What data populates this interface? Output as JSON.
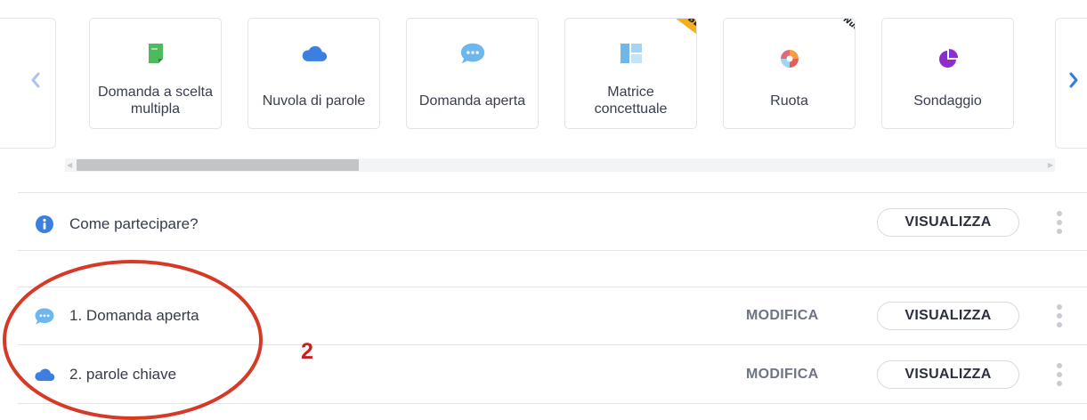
{
  "carousel": {
    "prev_icon": "chevron-left-icon",
    "next_icon": "chevron-right-icon",
    "cards": [
      {
        "label": "Domanda a scelta multipla",
        "icon": "document-icon",
        "color": "#4dbb5d"
      },
      {
        "label": "Nuvola di parole",
        "icon": "cloud-icon",
        "color": "#3d7fe0"
      },
      {
        "label": "Domanda aperta",
        "icon": "chat-bubble-icon",
        "color": "#67b6ee"
      },
      {
        "label": "Matrice concettuale",
        "icon": "grid-layout-icon",
        "color": "#6fb7e6"
      },
      {
        "label": "Ruota",
        "icon": "wheel-icon",
        "color": "#e6595a"
      },
      {
        "label": "Sondaggio",
        "icon": "pie-chart-icon",
        "color": "#8d2dcd"
      }
    ],
    "badges": {
      "beta": "BETA",
      "nuovo": "Nuovo"
    }
  },
  "info_row": {
    "icon": "info-icon",
    "text": "Come partecipare?",
    "view_label": "VISUALIZZA"
  },
  "activities": [
    {
      "number": "1.",
      "title": "Domanda aperta",
      "icon": "chat-bubble-icon",
      "edit_label": "MODIFICA",
      "view_label": "VISUALIZZA"
    },
    {
      "number": "2.",
      "title": "parole chiave",
      "icon": "cloud-icon",
      "edit_label": "MODIFICA",
      "view_label": "VISUALIZZA"
    }
  ],
  "annotation": {
    "number": "2",
    "color": "#d63a26"
  },
  "colors": {
    "accent_blue": "#3d7fe0",
    "badge_yellow": "#f5ae1c",
    "annotation_red": "#d63a26"
  }
}
